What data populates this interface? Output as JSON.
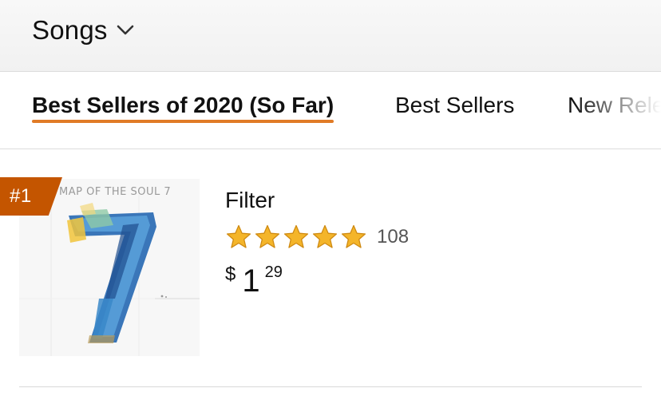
{
  "header": {
    "category_label": "Songs",
    "category_dropdown_icon": "chevron-down-icon"
  },
  "tabs": [
    {
      "label": "Best Sellers of 2020 (So Far)",
      "active": true
    },
    {
      "label": "Best Sellers",
      "active": false
    },
    {
      "label": "New Releases",
      "active": false
    }
  ],
  "list": {
    "items": [
      {
        "rank": "#1",
        "album_art_text": "MAP OF THE SOUL  7",
        "title": "Filter",
        "rating_stars": 5,
        "rating_count": "108",
        "price": {
          "symbol": "$",
          "whole": "1",
          "fraction": "29"
        }
      }
    ]
  },
  "colors": {
    "accent": "#e07b26",
    "rank_badge": "#c45500",
    "star": "#f4b52a"
  }
}
